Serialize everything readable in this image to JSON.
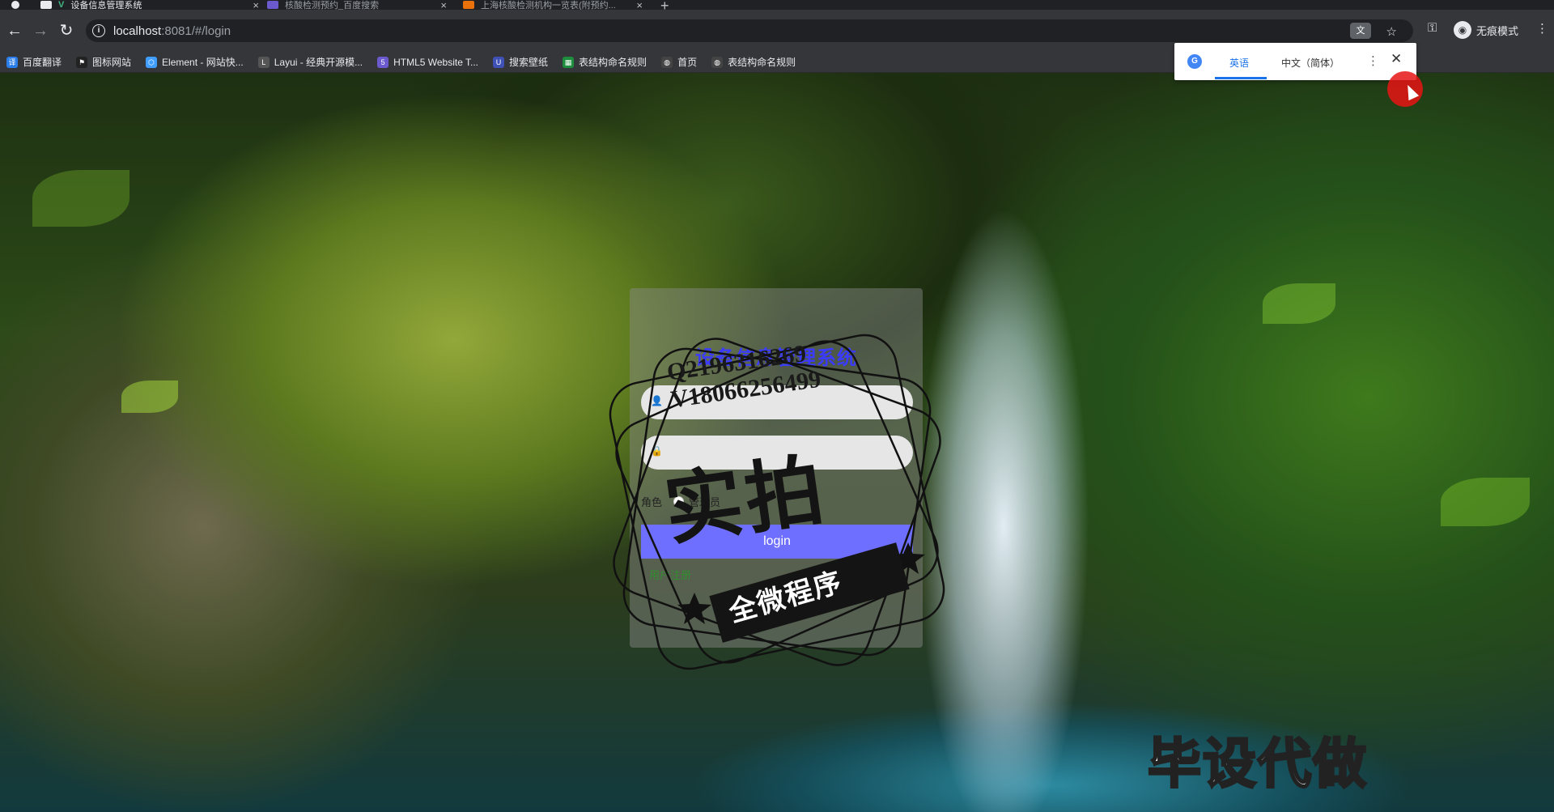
{
  "tabs": [
    {
      "title": "设备信息管理系统",
      "active": true
    },
    {
      "title": "核酸检测预约_百度搜索",
      "active": false
    },
    {
      "title": "上海核酸检测机构一览表(附预约...",
      "active": false
    }
  ],
  "address_bar": {
    "host": "localhost",
    "rest": ":8081/#/login"
  },
  "profile": {
    "label": "无痕模式"
  },
  "bookmarks": [
    {
      "label": "百度翻译",
      "icon": "baidu-translate-icon",
      "color": "#2b7de9"
    },
    {
      "label": "图标网站",
      "icon": "flag-icon",
      "color": "#222222"
    },
    {
      "label": "Element - 网站快...",
      "icon": "element-icon",
      "color": "#409eff"
    },
    {
      "label": "Layui - 经典开源模...",
      "icon": "layui-icon",
      "color": "#555555"
    },
    {
      "label": "HTML5 Website T...",
      "icon": "html5-icon",
      "color": "#6a5acd"
    },
    {
      "label": "搜索壁纸",
      "icon": "wallpaper-icon",
      "color": "#3f51b5"
    },
    {
      "label": "表结构命名规则",
      "icon": "sheet-icon",
      "color": "#1e8e3e"
    },
    {
      "label": "首页",
      "icon": "globe-icon",
      "color": "#444444"
    },
    {
      "label": "表结构命名规则",
      "icon": "globe-icon",
      "color": "#444444"
    }
  ],
  "translate_popup": {
    "source_lang": "英语",
    "target_lang": "中文（简体）"
  },
  "login": {
    "title": "设备信息管理系统",
    "username_placeholder": "",
    "password_placeholder": "",
    "role_label": "角色",
    "roles": [
      "管理员"
    ],
    "submit_label": "login",
    "register_link": "用户注册"
  },
  "watermark": {
    "qq": "Q2196316269",
    "vx": "V18066256499",
    "big": "实拍",
    "banner": "全微程序",
    "corner": "毕设代做"
  },
  "colors": {
    "title_blue": "#3b3bff",
    "button_purple": "#6f6fff",
    "link_green": "#2f8f2f"
  }
}
